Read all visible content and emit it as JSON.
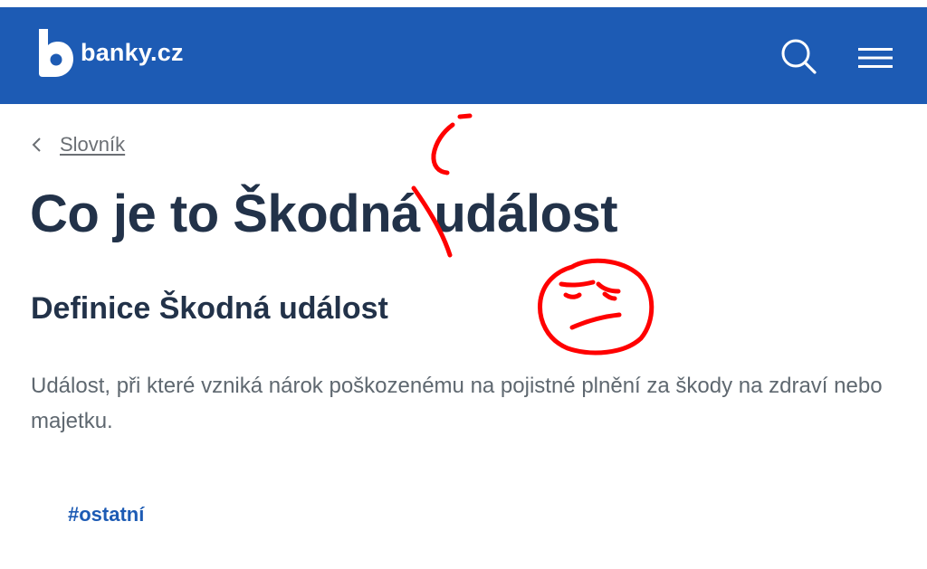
{
  "header": {
    "logo_text": "banky.cz",
    "accent_color": "#1d5bb4",
    "icons": [
      "banky-logo-icon",
      "search-icon",
      "hamburger-menu-icon"
    ]
  },
  "breadcrumb": {
    "icon": "chevron-left-icon",
    "label": "Slovník"
  },
  "article": {
    "title": "Co je to Škodná událost",
    "section_heading": "Definice Škodná událost",
    "definition": "Událost, při které vzniká nárok poškozenému na pojistné plnění za škody na zdraví nebo majetku.",
    "tag": "#ostatní"
  },
  "annotations": {
    "color": "#ff0000",
    "items": [
      "red-accent-correction-scribble",
      "angry-face-doodle"
    ]
  }
}
